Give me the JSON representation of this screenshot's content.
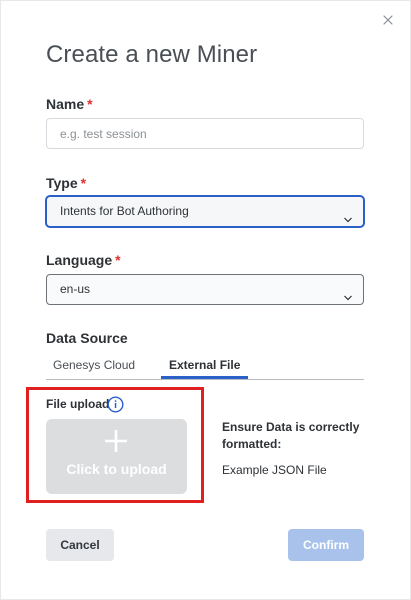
{
  "dialog": {
    "title": "Create a new Miner"
  },
  "fields": {
    "name": {
      "label": "Name",
      "required_mark": "*",
      "placeholder": "e.g. test session",
      "value": ""
    },
    "type": {
      "label": "Type",
      "required_mark": "*",
      "selected": "Intents for Bot Authoring"
    },
    "language": {
      "label": "Language",
      "required_mark": "*",
      "selected": "en-us"
    }
  },
  "data_source": {
    "label": "Data Source",
    "tabs": [
      {
        "label": "Genesys Cloud",
        "active": false
      },
      {
        "label": "External File",
        "active": true
      }
    ]
  },
  "upload": {
    "label": "File upload",
    "info_icon": "info-circle-icon",
    "button_text": "Click to upload",
    "plus_icon": "plus-icon",
    "hint_title": "Ensure Data is correctly formatted:",
    "example_link": "Example JSON File"
  },
  "actions": {
    "cancel_label": "Cancel",
    "confirm_label": "Confirm"
  },
  "colors": {
    "accent": "#2a60c8",
    "required": "#e0312f",
    "highlight_frame": "#e02020",
    "confirm_disabled": "#a9c2ec"
  }
}
